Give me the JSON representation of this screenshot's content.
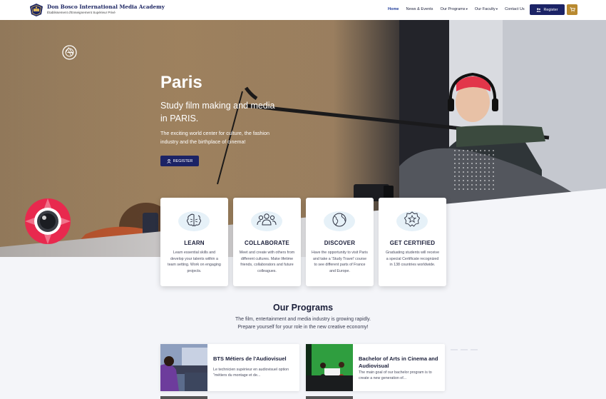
{
  "header": {
    "brand_name": "Don Bosco International Media Academy",
    "brand_tagline": "Établissement d'Enseignement Supérieur Privé",
    "nav": [
      {
        "label": "Home",
        "active": true,
        "dropdown": false
      },
      {
        "label": "News & Events",
        "active": false,
        "dropdown": false
      },
      {
        "label": "Our Programs",
        "active": false,
        "dropdown": true
      },
      {
        "label": "Our Faculty",
        "active": false,
        "dropdown": true
      },
      {
        "label": "Contact Us",
        "active": false,
        "dropdown": false
      }
    ],
    "register_label": "Register",
    "cart_icon": "cart-icon"
  },
  "hero": {
    "title": "Paris",
    "subtitle": "Study film making and media in PARIS.",
    "description": "The exciting world center for culture, the fashion industry and the birthplace of cinema!",
    "button_label": "REGISTER"
  },
  "features": [
    {
      "title": "LEARN",
      "icon": "brain-icon",
      "description": "Learn essential skills and develop your talents within a team setting. Work on engaging projects."
    },
    {
      "title": "COLLABORATE",
      "icon": "people-icon",
      "description": "Meet and create with others from different cultures. Make lifetime friends, collaborators and future colleagues."
    },
    {
      "title": "DISCOVER",
      "icon": "globe-icon",
      "description": "Have the opportunity to visit Paris and take a 'Study Travel' course to see different parts of France and Europe."
    },
    {
      "title": "GET CERTIFIED",
      "icon": "certificate-icon",
      "description": "Graduating students will receive a special Certificate recognized in 138 countries worldwide."
    }
  ],
  "programs": {
    "title": "Our Programs",
    "description_line1": "The film, entertainment and media industry is growing rapidly.",
    "description_line2": "Prepare yourself for your role in the new creative economy!",
    "items": [
      {
        "title": "BTS Métiers de l'Audiovisuel",
        "description": "Le technicien supérieur en audiovisuel option \"métiers du montage et de..."
      },
      {
        "title": "Bachelor of Arts in Cinema and Audiovisual",
        "description": "The main goal of our bachelor program is to create a new generation of..."
      }
    ]
  },
  "colors": {
    "navy": "#1b2366",
    "gold": "#b8892f",
    "accent_red": "#e8294e",
    "background": "#f4f5f9"
  }
}
